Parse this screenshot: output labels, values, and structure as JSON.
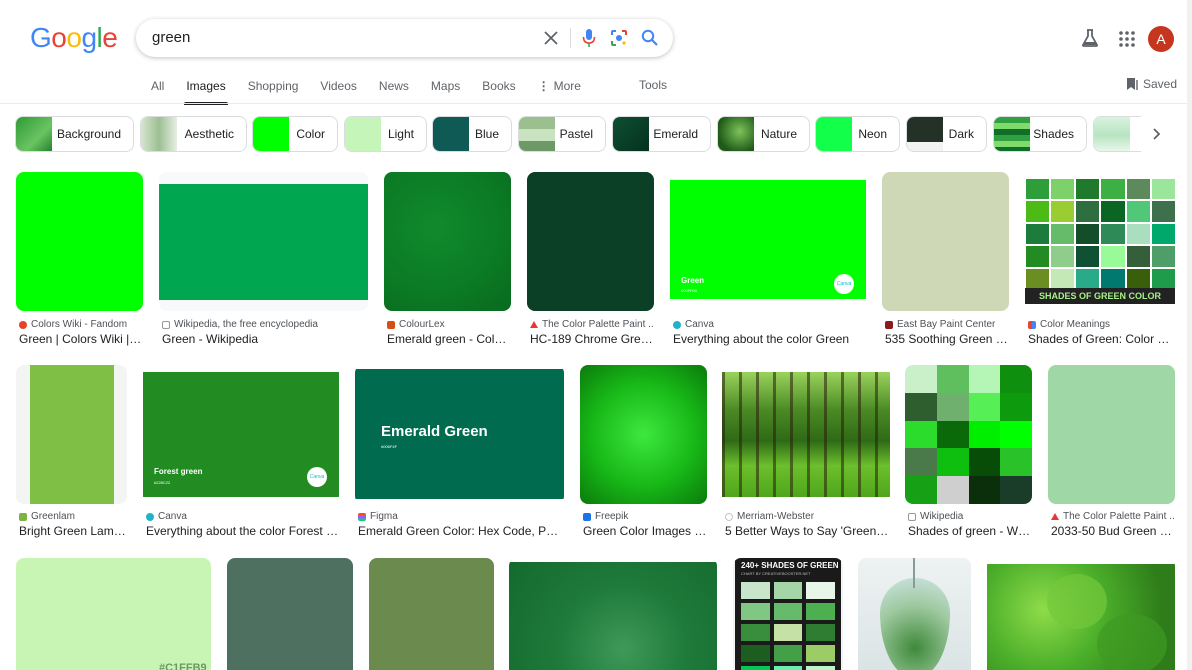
{
  "logo": {
    "letters": [
      "G",
      "o",
      "o",
      "g",
      "l",
      "e"
    ],
    "colors": [
      "#4285F4",
      "#EA4335",
      "#FBBC05",
      "#4285F4",
      "#34A853",
      "#EA4335"
    ]
  },
  "search": {
    "query": "green"
  },
  "header": {
    "avatar_letter": "A"
  },
  "tabs": [
    "All",
    "Images",
    "Shopping",
    "Videos",
    "News",
    "Maps",
    "Books",
    "More"
  ],
  "active_tab": "Images",
  "tools_label": "Tools",
  "saved_label": "Saved",
  "chips": [
    {
      "label": "Background",
      "color": "#2e9a33"
    },
    {
      "label": "Aesthetic",
      "color": "#a7c69f"
    },
    {
      "label": "Color",
      "color": "#00ff00"
    },
    {
      "label": "Light",
      "color": "#c5f5b8"
    },
    {
      "label": "Blue",
      "color": "#0f5a55"
    },
    {
      "label": "Pastel",
      "color": "#9bbf8e"
    },
    {
      "label": "Emerald",
      "color": "#0d4f32"
    },
    {
      "label": "Nature",
      "color": "#2b6d22"
    },
    {
      "label": "Neon",
      "color": "#12ff4a"
    },
    {
      "label": "Dark",
      "color": "#233127"
    },
    {
      "label": "Shades",
      "color": "#30a040"
    },
    {
      "label": "",
      "color": "#d9f3df"
    }
  ],
  "row1": [
    {
      "source": "Colors Wiki - Fandom",
      "title": "Green | Colors Wiki | F...",
      "color": "#00ff00",
      "fav": "#e8412b"
    },
    {
      "source": "Wikipedia, the free encyclopedia",
      "title": "Green - Wikipedia",
      "color": "#00a650",
      "fav": "#555555"
    },
    {
      "source": "ColourLex",
      "title": "Emerald green - Colour...",
      "color": "#0b7a24",
      "fav": "#d94d14"
    },
    {
      "source": "The Color Palette Paint ...",
      "title": "HC-189 Chrome Green ...",
      "color": "#0b4027",
      "fav": "#e53935"
    },
    {
      "source": "Canva",
      "title": "Everything about the color Green",
      "color": "#00ff00",
      "fav": "#20b3c8",
      "img_label": "Green",
      "img_sub": "#00FF00",
      "img_brand": "Canva"
    },
    {
      "source": "East Bay Paint Center",
      "title": "535 Soothing Green - P...",
      "color": "#cfd8b6",
      "fav": "#8b1a1a"
    },
    {
      "source": "Color Meanings",
      "title": "Shades of Green: Color Na...",
      "color": "#2b9a3b",
      "fav": "#4285f4",
      "img_banner": "SHADES OF GREEN COLOR"
    }
  ],
  "row2": [
    {
      "source": "Greenlam",
      "title": "Bright Green Lamin...",
      "color": "#7fbf45",
      "fav": "#7cb342"
    },
    {
      "source": "Canva",
      "title": "Everything about the color Forest Gr...",
      "color": "#228c22",
      "fav": "#20b3c8",
      "img_label": "Forest green",
      "img_sub": "#228C22",
      "img_brand": "Canva"
    },
    {
      "source": "Figma",
      "title": "Emerald Green Color: Hex Code, Palett...",
      "color": "#006b4f",
      "fav": "#f24e1e",
      "img_label": "Emerald Green",
      "img_sub": "#006F4F"
    },
    {
      "source": "Freepik",
      "title": "Green Color Images - F...",
      "color": "#1fcc1f",
      "fav": "#1a73e8"
    },
    {
      "source": "Merriam-Webster",
      "title": "5 Better Ways to Say 'Green' | ...",
      "color": "#3a8c1e",
      "fav": "#c5c5c5"
    },
    {
      "source": "Wikipedia",
      "title": "Shades of green - Wiki...",
      "color": "#01a000",
      "fav": "#555555"
    },
    {
      "source": "The Color Palette Paint ...",
      "title": "2033-50 Bud Green - P...",
      "color": "#9fd8a6",
      "fav": "#e53935"
    }
  ],
  "row3": [
    {
      "color": "#c8f5b4",
      "img_label": "#C1FFB9"
    },
    {
      "color": "#4e7060"
    },
    {
      "color": "#6b8a4e"
    },
    {
      "color": "#1e7a3a"
    },
    {
      "color": "#1a1a1a",
      "img_label": "240+ SHADES OF GREEN",
      "img_sub": "CHART BY CREATIVEBOOSTER.NET"
    },
    {
      "color": "#e9eef0"
    },
    {
      "color": "#4caf2a"
    }
  ]
}
